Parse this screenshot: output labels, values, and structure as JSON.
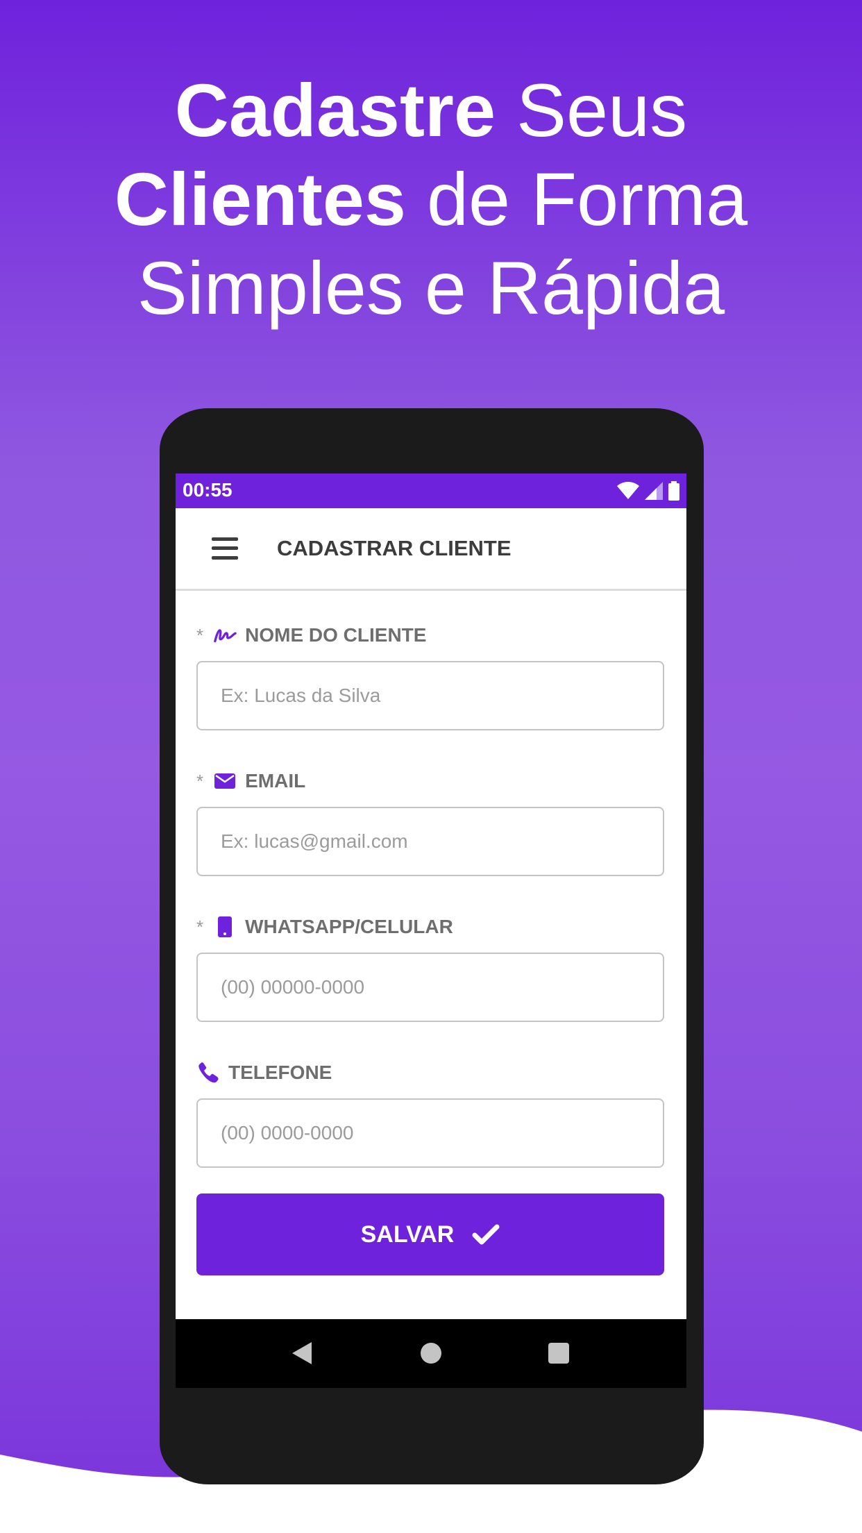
{
  "headline": {
    "line1_bold": "Cadastre",
    "line1_rest": " Seus",
    "line2_bold": "Clientes",
    "line2_rest": " de Forma",
    "line3": "Simples e Rápida"
  },
  "statusbar": {
    "time": "00:55",
    "icons": [
      "wifi-icon",
      "signal-icon",
      "battery-icon"
    ]
  },
  "appbar": {
    "menu_icon": "menu-icon",
    "title": "CADASTRAR CLIENTE"
  },
  "form": {
    "fields": [
      {
        "required_mark": "*",
        "icon": "signature-icon",
        "label": "NOME DO CLIENTE",
        "value": "",
        "placeholder": "Ex: Lucas da Silva"
      },
      {
        "required_mark": "*",
        "icon": "envelope-icon",
        "label": "EMAIL",
        "value": "",
        "placeholder": "Ex: lucas@gmail.com"
      },
      {
        "required_mark": "*",
        "icon": "mobile-phone-icon",
        "label": "WHATSAPP/CELULAR",
        "value": "",
        "placeholder": "(00) 00000-0000"
      },
      {
        "required_mark": "",
        "icon": "phone-icon",
        "label": "TELEFONE",
        "value": "",
        "placeholder": "(00) 0000-0000"
      }
    ],
    "save_label": "SALVAR",
    "save_icon": "check-icon"
  },
  "navbar": {
    "icons": [
      "back-icon",
      "home-icon",
      "recents-icon"
    ]
  },
  "colors": {
    "brand": "#6f22dc",
    "phone_frame": "#1b1b1b",
    "label_text": "#6e6e6e",
    "placeholder_text": "#9b9b9b"
  }
}
